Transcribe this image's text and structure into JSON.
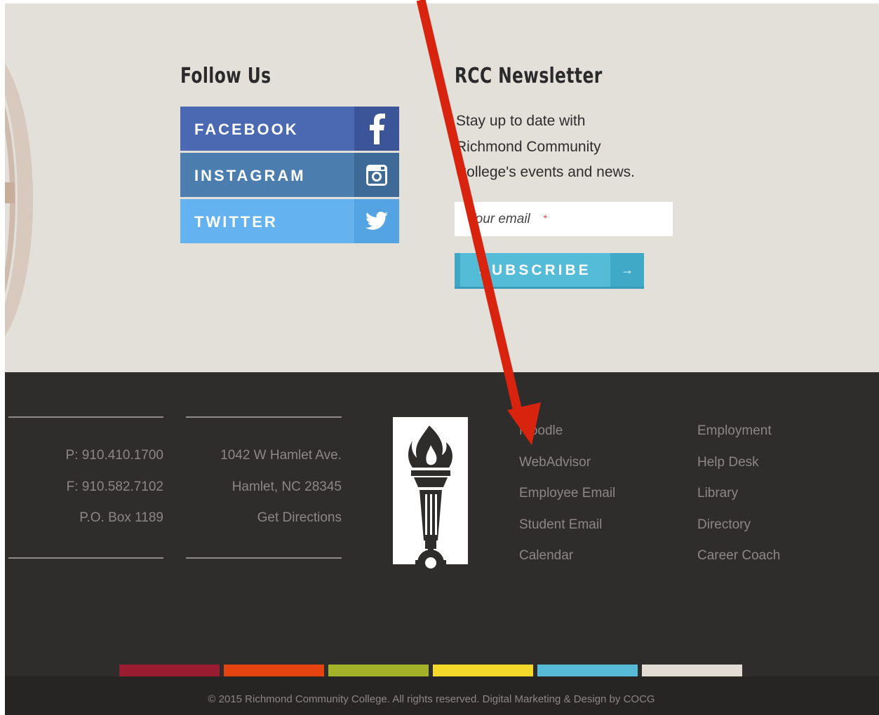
{
  "follow": {
    "heading": "Follow Us",
    "buttons": [
      {
        "label": "FACEBOOK",
        "icon": "facebook-icon"
      },
      {
        "label": "INSTAGRAM",
        "icon": "instagram-icon"
      },
      {
        "label": "TWITTER",
        "icon": "twitter-icon"
      }
    ]
  },
  "newsletter": {
    "heading": "RCC Newsletter",
    "lines": [
      "Stay up to date with",
      "Richmond Community",
      "College's events and news."
    ],
    "email_placeholder": "Your email",
    "required_mark": "*",
    "subscribe_label": "SUBSCRIBE",
    "subscribe_arrow": "→"
  },
  "contact": {
    "phone": "P: 910.410.1700",
    "fax": "F: 910.582.7102",
    "po_box": "P.O. Box 1189"
  },
  "address": {
    "street": "1042 W Hamlet Ave.",
    "city": "Hamlet, NC 28345",
    "directions": "Get Directions"
  },
  "links_col1": [
    "Moodle",
    "WebAdvisor",
    "Employee Email",
    "Student Email",
    "Calendar"
  ],
  "links_col2": [
    "Employment",
    "Help Desk",
    "Library",
    "Directory",
    "Career Coach"
  ],
  "color_bar": [
    "#9a1c31",
    "#e54410",
    "#a4b229",
    "#f4d92b",
    "#57bad7",
    "#e2dcd4"
  ],
  "copyright": "© 2015 Richmond Community College. All rights reserved. Digital Marketing & Design by COCG",
  "colors": {
    "beige": "#e3dfd9",
    "footer_dark": "#2f2d2c",
    "annotation_arrow": "#d8230f"
  }
}
